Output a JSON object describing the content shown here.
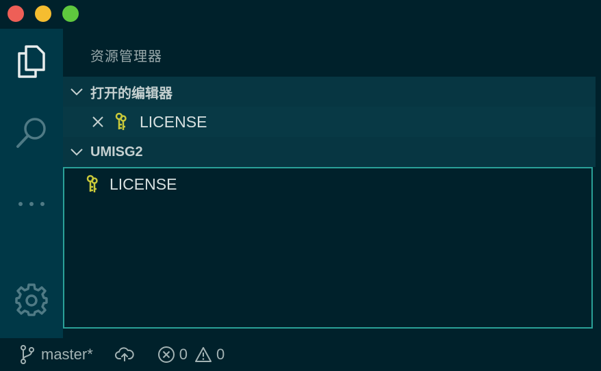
{
  "window": {
    "controls": [
      "close",
      "minimize",
      "maximize"
    ]
  },
  "activity_bar": {
    "items": [
      "explorer-icon",
      "search-icon",
      "more-icon"
    ],
    "bottom_item": "gear-icon"
  },
  "sidebar": {
    "title": "资源管理器",
    "open_editors": {
      "header": "打开的编辑器",
      "items": [
        {
          "label": "LICENSE",
          "icon": "license-key-icon"
        }
      ]
    },
    "workspace": {
      "header": "UMISG2",
      "files": [
        {
          "label": "LICENSE",
          "icon": "license-key-icon"
        }
      ]
    }
  },
  "status_bar": {
    "branch": "master*",
    "errors": "0",
    "warnings": "0"
  },
  "colors": {
    "background": "#002b36",
    "accent": "#2aa198",
    "license_icon": "#c9c93a"
  }
}
